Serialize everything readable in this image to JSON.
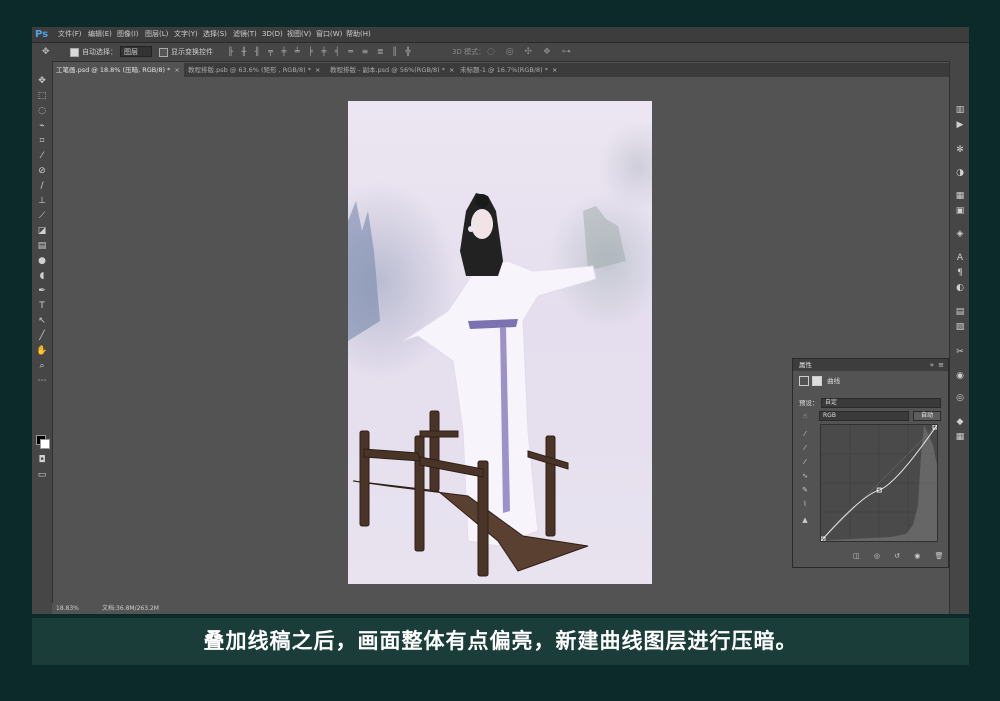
{
  "app": {
    "logo": "Ps"
  },
  "menubar": [
    "文件(F)",
    "编辑(E)",
    "图像(I)",
    "图层(L)",
    "文字(Y)",
    "选择(S)",
    "滤镜(T)",
    "3D(D)",
    "视图(V)",
    "窗口(W)",
    "帮助(H)"
  ],
  "options": {
    "auto_select_label": "自动选择：",
    "auto_select_value": "图层",
    "show_transform_label": "显示变换控件",
    "mode_3d_label": "3D 模式："
  },
  "tabs": [
    {
      "label": "工笔画.psd @ 18.8% (压暗, RGB/8) *",
      "active": true
    },
    {
      "label": "教程排版.psb @ 63.6% (矩形 , RGB/8) *",
      "active": false
    },
    {
      "label": "教程排版 - 副本.psd @ 56%(RGB/8) *",
      "active": false
    },
    {
      "label": "未标题-1 @ 16.7%(RGB/8) *",
      "active": false
    }
  ],
  "status": {
    "zoom": "18.83%",
    "doc": "文档:36.8M/263.2M"
  },
  "properties_panel": {
    "title": "属性",
    "adjustment": "曲线",
    "preset_label": "预设：",
    "preset_value": "自定",
    "channel_value": "RGB",
    "auto_label": "自动"
  },
  "curve": {
    "points": [
      [
        0,
        0
      ],
      [
        128,
        112
      ],
      [
        255,
        255
      ]
    ]
  },
  "caption": "叠加线稿之后，画面整体有点偏亮，新建曲线图层进行压暗。",
  "colors": {
    "frame_bg": "#0d2a2a",
    "caption_bg": "#1a3d3a",
    "ps_blue": "#4aa3e6"
  }
}
